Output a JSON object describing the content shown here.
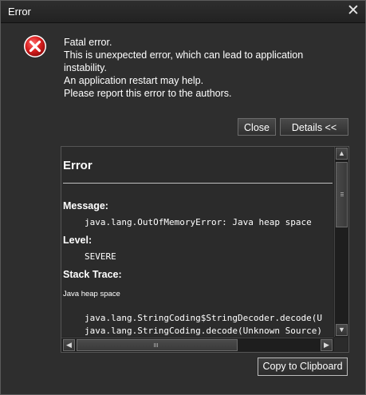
{
  "window": {
    "title": "Error",
    "close_glyph": "✕"
  },
  "icon": "error-icon",
  "message": {
    "line1": "Fatal error.",
    "line2": "This is unexpected error, which can lead to application",
    "line3": "instability.",
    "line4": "An application restart may help.",
    "line5": "Please report this error to the authors."
  },
  "buttons": {
    "close": "Close",
    "details": "Details <<",
    "copy": "Copy to Clipboard"
  },
  "details": {
    "heading": "Error",
    "message_label": "Message:",
    "message_value": "java.lang.OutOfMemoryError: Java heap space",
    "level_label": "Level:",
    "level_value": "SEVERE",
    "stack_label": "Stack Trace:",
    "stack_summary": "Java heap space",
    "stack_line1": "java.lang.StringCoding$StringDecoder.decode(U",
    "stack_line2": "java.lang.StringCoding.decode(Unknown Source)"
  },
  "colors": {
    "window_bg": "#2e2e2e",
    "error_red": "#d81e1e",
    "text": "#ffffff"
  }
}
